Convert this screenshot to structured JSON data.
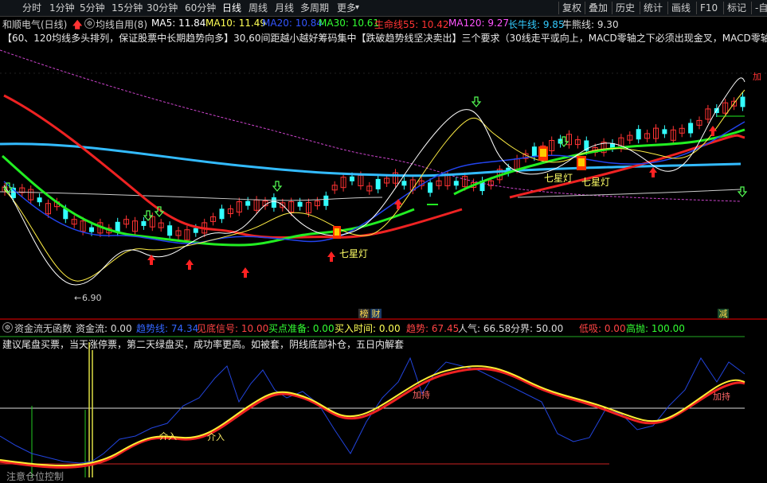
{
  "toolbar": {
    "stock_name": "和顺电气(日线)",
    "periods": [
      "分时",
      "1分钟",
      "5分钟",
      "15分钟",
      "30分钟",
      "60分钟",
      "日线",
      "周线",
      "月线",
      "多周期",
      "更多"
    ],
    "right_buttons": [
      "复权",
      "叠加",
      "历史",
      "统计",
      "画线",
      "F10",
      "标记",
      "-自选"
    ]
  },
  "ma_row": {
    "indicator_name": "均线自用(8)",
    "items": [
      {
        "label": "MA5: 11.84",
        "color": "#ffffff"
      },
      {
        "label": "MA10: 11.49",
        "color": "#ffff55"
      },
      {
        "label": "MA20: 10.84",
        "color": "#3355ff"
      },
      {
        "label": "MA30: 10.61",
        "color": "#33ff33"
      },
      {
        "label": "生命线55: 10.42",
        "color": "#ff3333"
      },
      {
        "label": "MA120: 9.27",
        "color": "#ff55ff"
      },
      {
        "label": "长牛线: 9.85",
        "color": "#33ccff"
      },
      {
        "label": "牛熊线: 9.30",
        "color": "#dddddd"
      }
    ]
  },
  "notice": "【60、120均线多头排列，保证股票中长期趋势向多】30,60间距越小越好筹码集中【跌破趋势线坚决卖出】三个要求（30线走平或向上，MACD零轴之下必须出现金叉，MACD零轴之",
  "price_labels": {
    "low": "6.90",
    "pattern": "七星灯"
  },
  "tags": {
    "tag1": "榜",
    "tag2": "财",
    "tag3": "减"
  },
  "indicator_row": {
    "name": "资金流无函数",
    "items": [
      {
        "label": "资金流: 0.00",
        "color": "#dddddd"
      },
      {
        "label": "趋势线: 74.34",
        "color": "#3366ff"
      },
      {
        "label": "见底信号: 10.00",
        "color": "#ff4444"
      },
      {
        "label": "买点准备: 0.00",
        "color": "#33ff33"
      },
      {
        "label": "买入时间: 0.00",
        "color": "#ffff55"
      },
      {
        "label": "趋势: 67.45",
        "color": "#ff4444"
      },
      {
        "label": "人气: 66.58",
        "color": "#dddddd"
      },
      {
        "label": "分界: 50.00",
        "color": "#dddddd"
      },
      {
        "label": "低吸: 0.00",
        "color": "#ff4444"
      },
      {
        "label": "高抛: 100.00",
        "color": "#33ff33"
      }
    ]
  },
  "tip": "建议尾盘买票，当天涨停票，第二天绿盘买，成功率更高。如被套，阴线底部补仓，五日内解套",
  "sub_labels": {
    "hold": "加持",
    "enter": "介入"
  },
  "bottom_tip": "注意仓位控制",
  "colors": {
    "up": "#ff3333",
    "down": "#33ffff",
    "accent": "#ff3333",
    "bg": "#000000"
  }
}
